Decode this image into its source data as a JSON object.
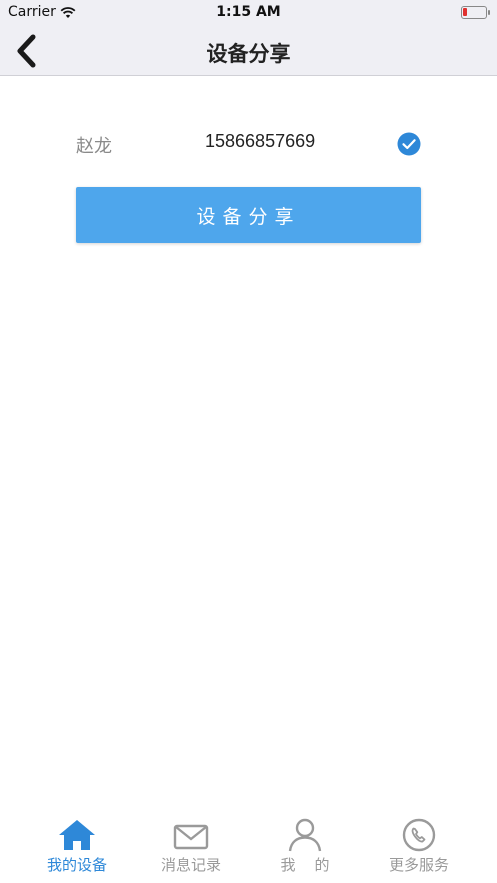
{
  "status_bar": {
    "carrier": "Carrier",
    "time": "1:15 AM",
    "battery_color": "#e0302e"
  },
  "nav": {
    "title": "设备分享",
    "back_icon": "chevron-left-icon"
  },
  "share_row": {
    "name": "赵龙",
    "phone": "15866857669",
    "selected": true,
    "check_icon": "check-circle-icon"
  },
  "share_button": {
    "label": "设备分享",
    "color": "#4ea6ec"
  },
  "tab_bar": {
    "active_color": "#2e88d8",
    "inactive_color": "#9a9a9a",
    "tabs": [
      {
        "label": "我的设备",
        "icon": "home-icon",
        "active": true
      },
      {
        "label": "消息记录",
        "icon": "envelope-icon",
        "active": false
      },
      {
        "label": "我    的",
        "icon": "user-icon",
        "active": false
      },
      {
        "label": "更多服务",
        "icon": "phone-circle-icon",
        "active": false
      }
    ]
  }
}
